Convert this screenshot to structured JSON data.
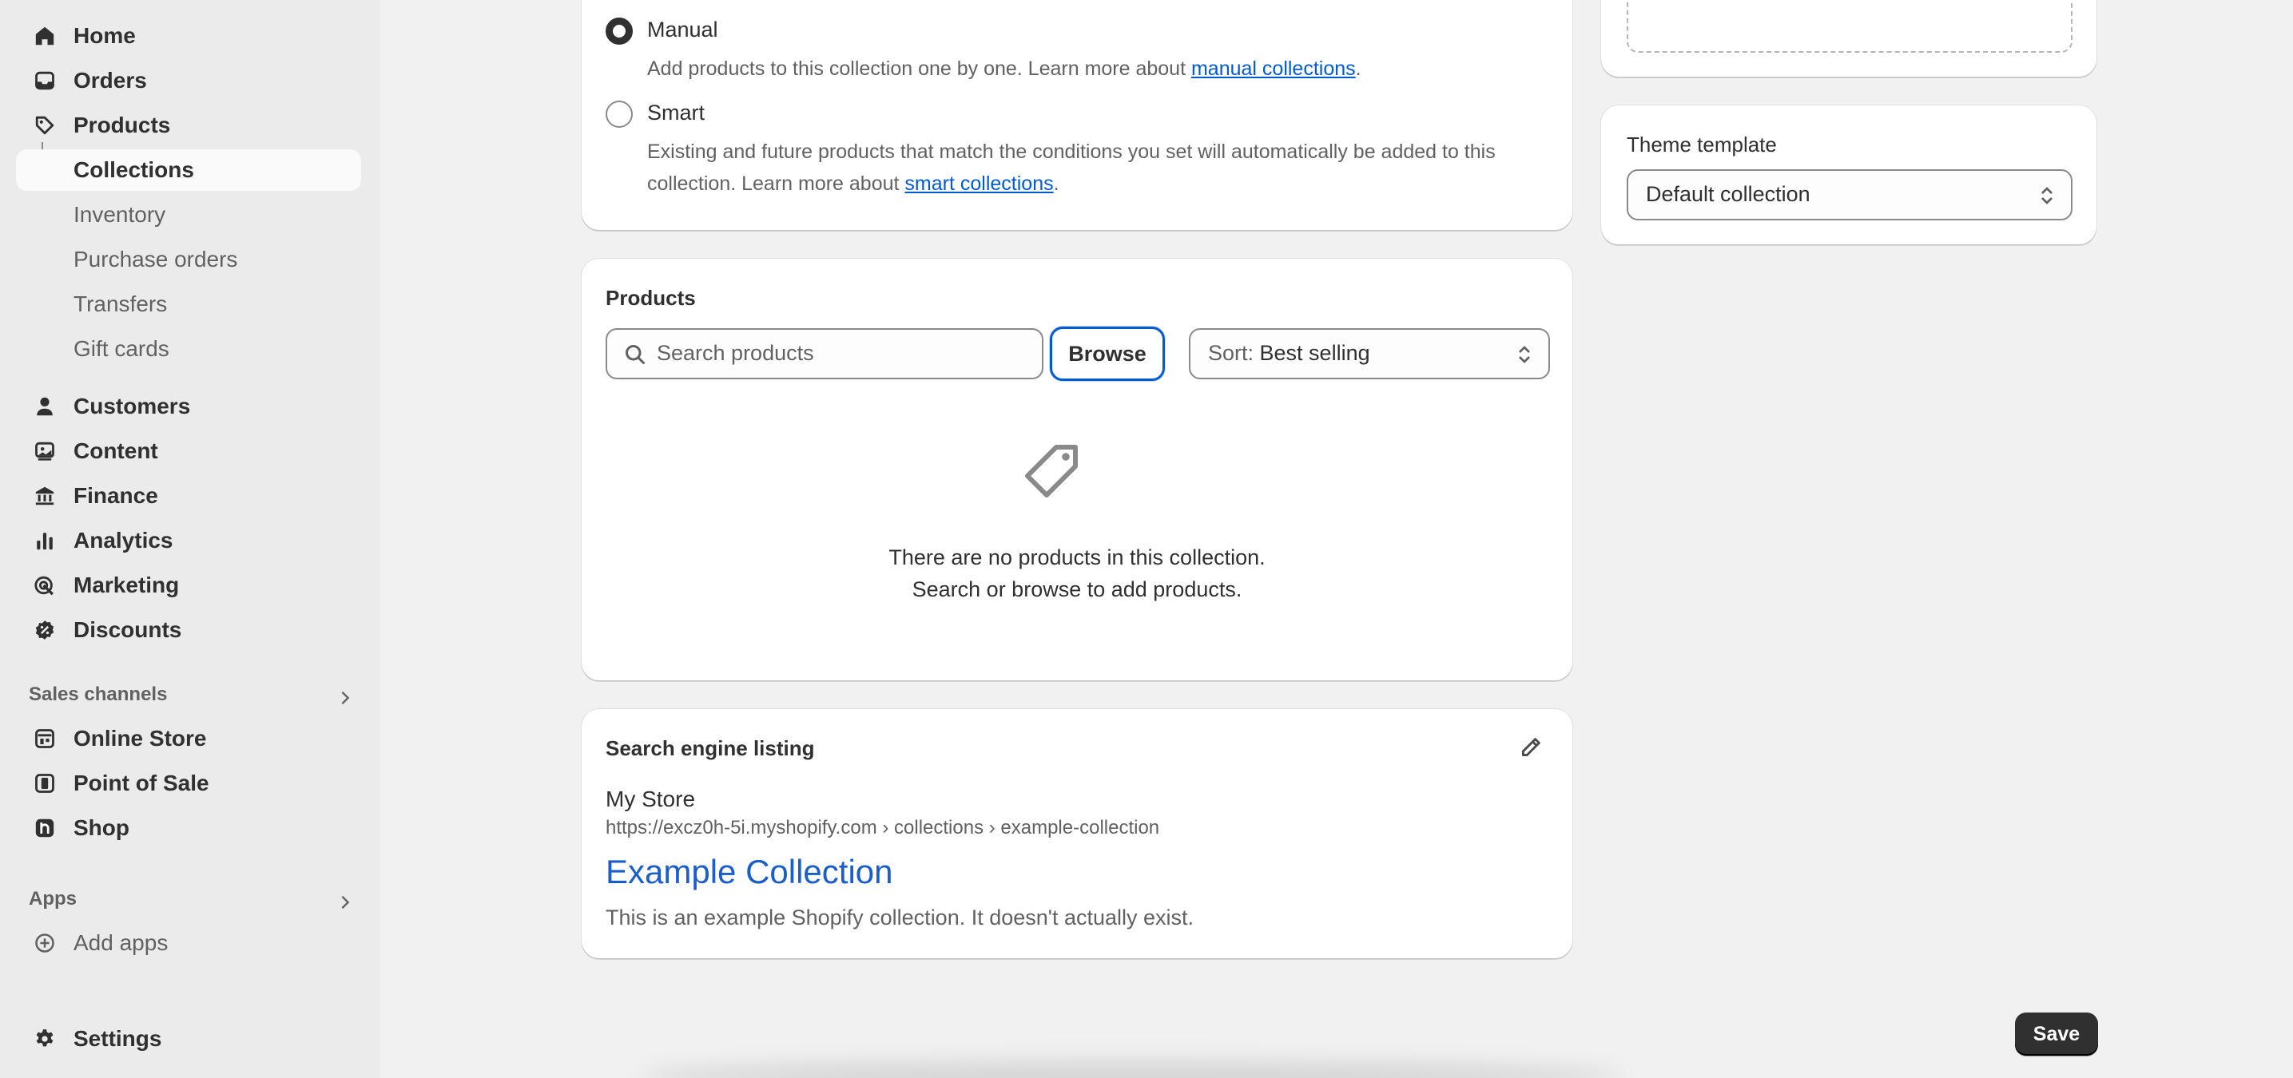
{
  "sidebar": {
    "items": [
      {
        "label": "Home",
        "icon": "home-icon"
      },
      {
        "label": "Orders",
        "icon": "inbox-icon"
      },
      {
        "label": "Products",
        "icon": "tag-icon"
      },
      {
        "label": "Collections"
      },
      {
        "label": "Inventory"
      },
      {
        "label": "Purchase orders"
      },
      {
        "label": "Transfers"
      },
      {
        "label": "Gift cards"
      },
      {
        "label": "Customers",
        "icon": "person-icon"
      },
      {
        "label": "Content",
        "icon": "image-icon"
      },
      {
        "label": "Finance",
        "icon": "bank-icon"
      },
      {
        "label": "Analytics",
        "icon": "bar-chart-icon"
      },
      {
        "label": "Marketing",
        "icon": "target-icon"
      },
      {
        "label": "Discounts",
        "icon": "discount-icon"
      }
    ],
    "sales_channels": {
      "label": "Sales channels",
      "items": [
        {
          "label": "Online Store",
          "icon": "store-icon"
        },
        {
          "label": "Point of Sale",
          "icon": "pos-icon"
        },
        {
          "label": "Shop",
          "icon": "shop-icon"
        }
      ]
    },
    "apps": {
      "label": "Apps",
      "items": [
        {
          "label": "Add apps",
          "icon": "plus-circle-icon"
        }
      ]
    },
    "settings": {
      "label": "Settings",
      "icon": "gear-icon"
    }
  },
  "collection_type": {
    "manual": {
      "label": "Manual",
      "help_prefix": "Add products to this collection one by one. Learn more about ",
      "help_link": "manual collections",
      "help_suffix": "."
    },
    "smart": {
      "label": "Smart",
      "help_line1": "Existing and future products that match the conditions you set will automatically be added to this",
      "help_line2_prefix": "collection. Learn more about ",
      "help_link": "smart collections",
      "help_suffix": "."
    },
    "selected": "Manual"
  },
  "products": {
    "title": "Products",
    "search_placeholder": "Search products",
    "browse_label": "Browse",
    "sort_prefix": "Sort: ",
    "sort_value": "Best selling",
    "empty_line1": "There are no products in this collection.",
    "empty_line2": "Search or browse to add products."
  },
  "seo": {
    "title": "Search engine listing",
    "store": "My Store",
    "url": "https://excz0h-5i.myshopify.com › collections › example-collection",
    "page_title": "Example Collection",
    "description": "This is an example Shopify collection. It doesn't actually exist."
  },
  "theme_template": {
    "label": "Theme template",
    "value": "Default collection"
  },
  "actions": {
    "save_label": "Save"
  }
}
